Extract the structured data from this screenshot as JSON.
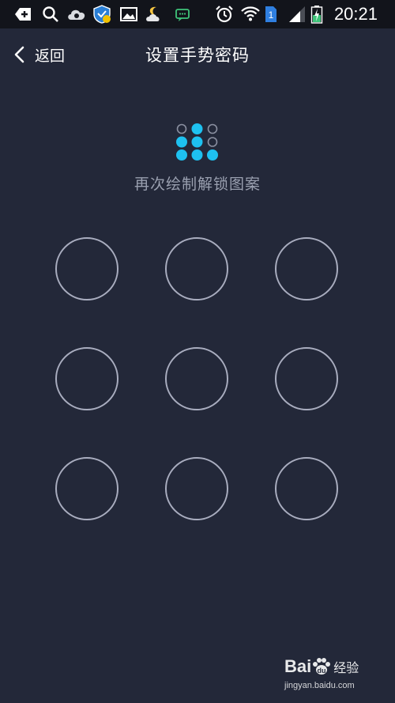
{
  "status_bar": {
    "time": "20:21",
    "sim_badge": "1",
    "icons": [
      "add-icon",
      "search-icon",
      "cloud-icon",
      "shield-icon",
      "image-icon",
      "weather-icon",
      "message-icon",
      "alarm-icon",
      "wifi-icon",
      "sim-icon",
      "signal-icon",
      "battery-icon"
    ]
  },
  "header": {
    "back_label": "返回",
    "title": "设置手势密码"
  },
  "pattern_preview": {
    "rows": [
      [
        false,
        true,
        false
      ],
      [
        true,
        true,
        false
      ],
      [
        true,
        true,
        true
      ]
    ],
    "filled_color": "#1ec1f0",
    "empty_color": "#8a8fa0"
  },
  "hint": "再次绘制解锁图案",
  "grid": {
    "rows": 3,
    "cols": 3,
    "ring_color": "#a9adbf"
  },
  "watermark": {
    "brand": "Bai",
    "brand_cn": "经验",
    "url": "jingyan.baidu.com"
  },
  "colors": {
    "background": "#232839",
    "status_bar": "#12141b",
    "accent": "#1ec1f0"
  }
}
